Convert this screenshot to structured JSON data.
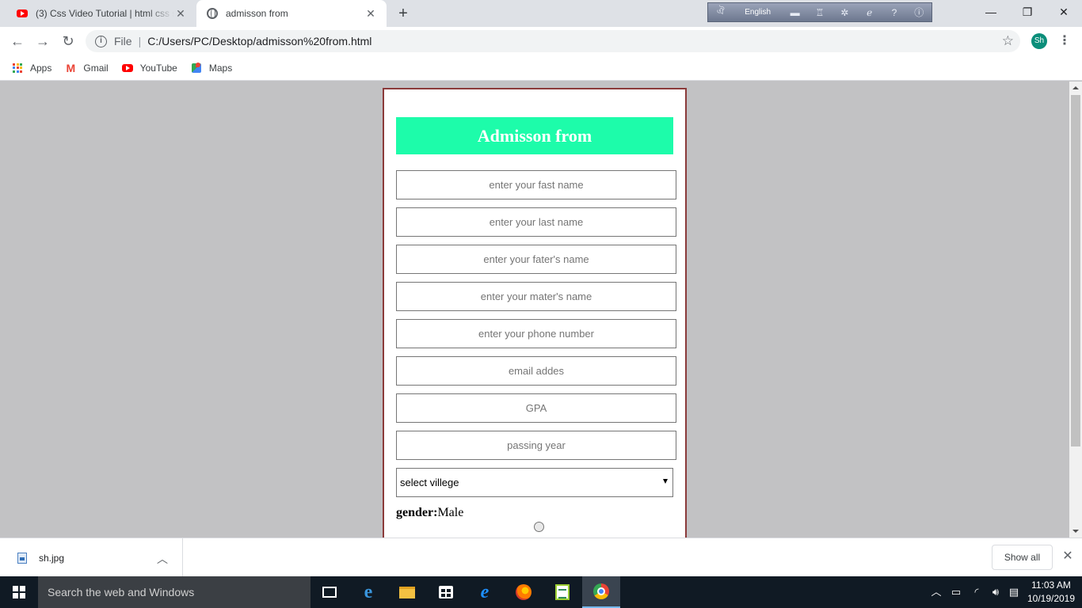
{
  "browser": {
    "tabs": [
      {
        "title": "(3) Css Video Tutorial | html css s",
        "icon": "youtube-icon"
      },
      {
        "title": "admisson from",
        "icon": "globe-icon"
      }
    ],
    "language_bar": {
      "language": "English"
    },
    "address": {
      "scheme_label": "File",
      "url": "C:/Users/PC/Desktop/admisson%20from.html"
    },
    "profile_initials": "Sh",
    "bookmarks": [
      {
        "label": "Apps",
        "icon": "apps-grid-icon"
      },
      {
        "label": "Gmail",
        "icon": "gmail-icon"
      },
      {
        "label": "YouTube",
        "icon": "youtube-icon"
      },
      {
        "label": "Maps",
        "icon": "maps-icon"
      }
    ]
  },
  "form": {
    "title": "Admisson from",
    "fields": [
      {
        "name": "first-name-input",
        "placeholder": "enter your fast name"
      },
      {
        "name": "last-name-input",
        "placeholder": "enter your last name"
      },
      {
        "name": "father-name-input",
        "placeholder": "enter your fater's name"
      },
      {
        "name": "mother-name-input",
        "placeholder": "enter your mater's name"
      },
      {
        "name": "phone-input",
        "placeholder": "enter your phone number"
      },
      {
        "name": "email-input",
        "placeholder": "email addes"
      },
      {
        "name": "gpa-input",
        "placeholder": "GPA"
      },
      {
        "name": "passing-year-input",
        "placeholder": "passing year"
      }
    ],
    "village_select": {
      "selected": "select villege"
    },
    "gender": {
      "label": "gender:",
      "option": "Male"
    },
    "accent_color": "#1dfcaa",
    "border_color": "#8b3a3a"
  },
  "downloads": {
    "file": "sh.jpg",
    "show_all": "Show all"
  },
  "taskbar": {
    "search_placeholder": "Search the web and Windows",
    "time": "11:03 AM",
    "date": "10/19/2019"
  }
}
